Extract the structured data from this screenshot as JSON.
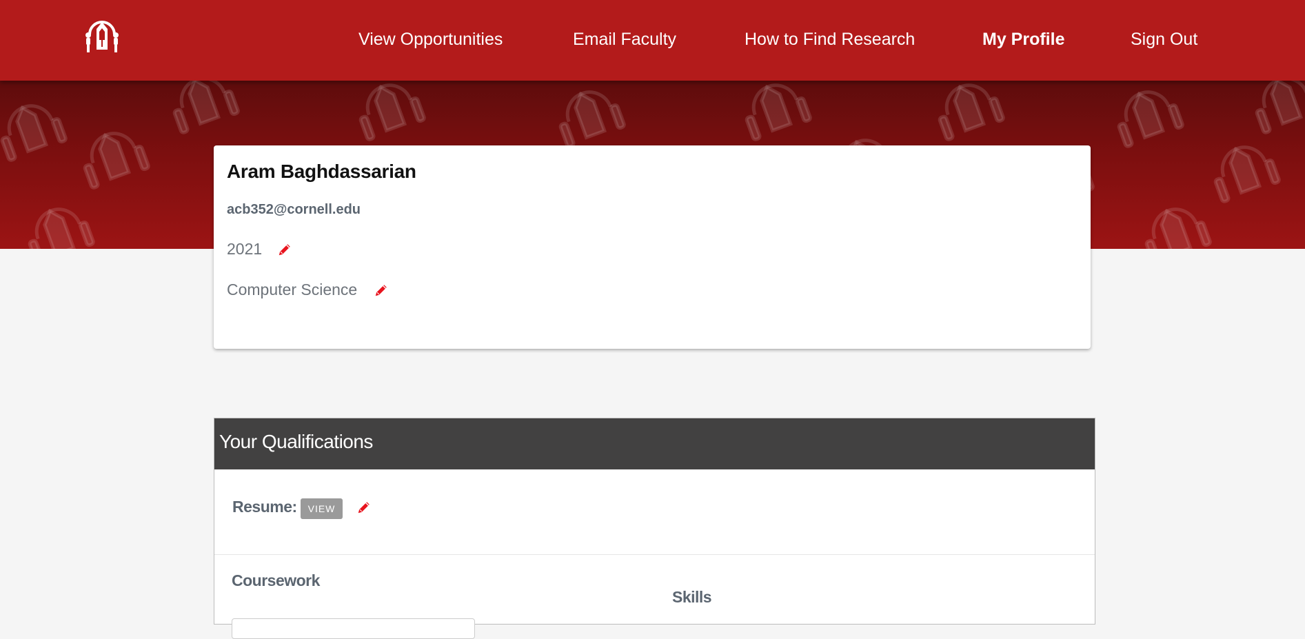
{
  "nav": {
    "logo": "logo-icon",
    "items": [
      {
        "label": "View Opportunities",
        "active": false
      },
      {
        "label": "Email Faculty",
        "active": false
      },
      {
        "label": "How to Find Research",
        "active": false
      },
      {
        "label": "My Profile",
        "active": true
      },
      {
        "label": "Sign Out",
        "active": false
      }
    ]
  },
  "profile": {
    "name": "Aram Baghdassarian",
    "email": "acb352@cornell.edu",
    "year": "2021",
    "major": "Computer Science"
  },
  "qualifications": {
    "title": "Your Qualifications",
    "resume_label": "Resume:",
    "view_label": "VIEW",
    "coursework_label": "Coursework",
    "skills_label": "Skills"
  },
  "colors": {
    "nav_bg": "#b31b1b",
    "banner": "#8b1010",
    "edit_icon": "#e8141e",
    "qual_header": "#424141"
  }
}
